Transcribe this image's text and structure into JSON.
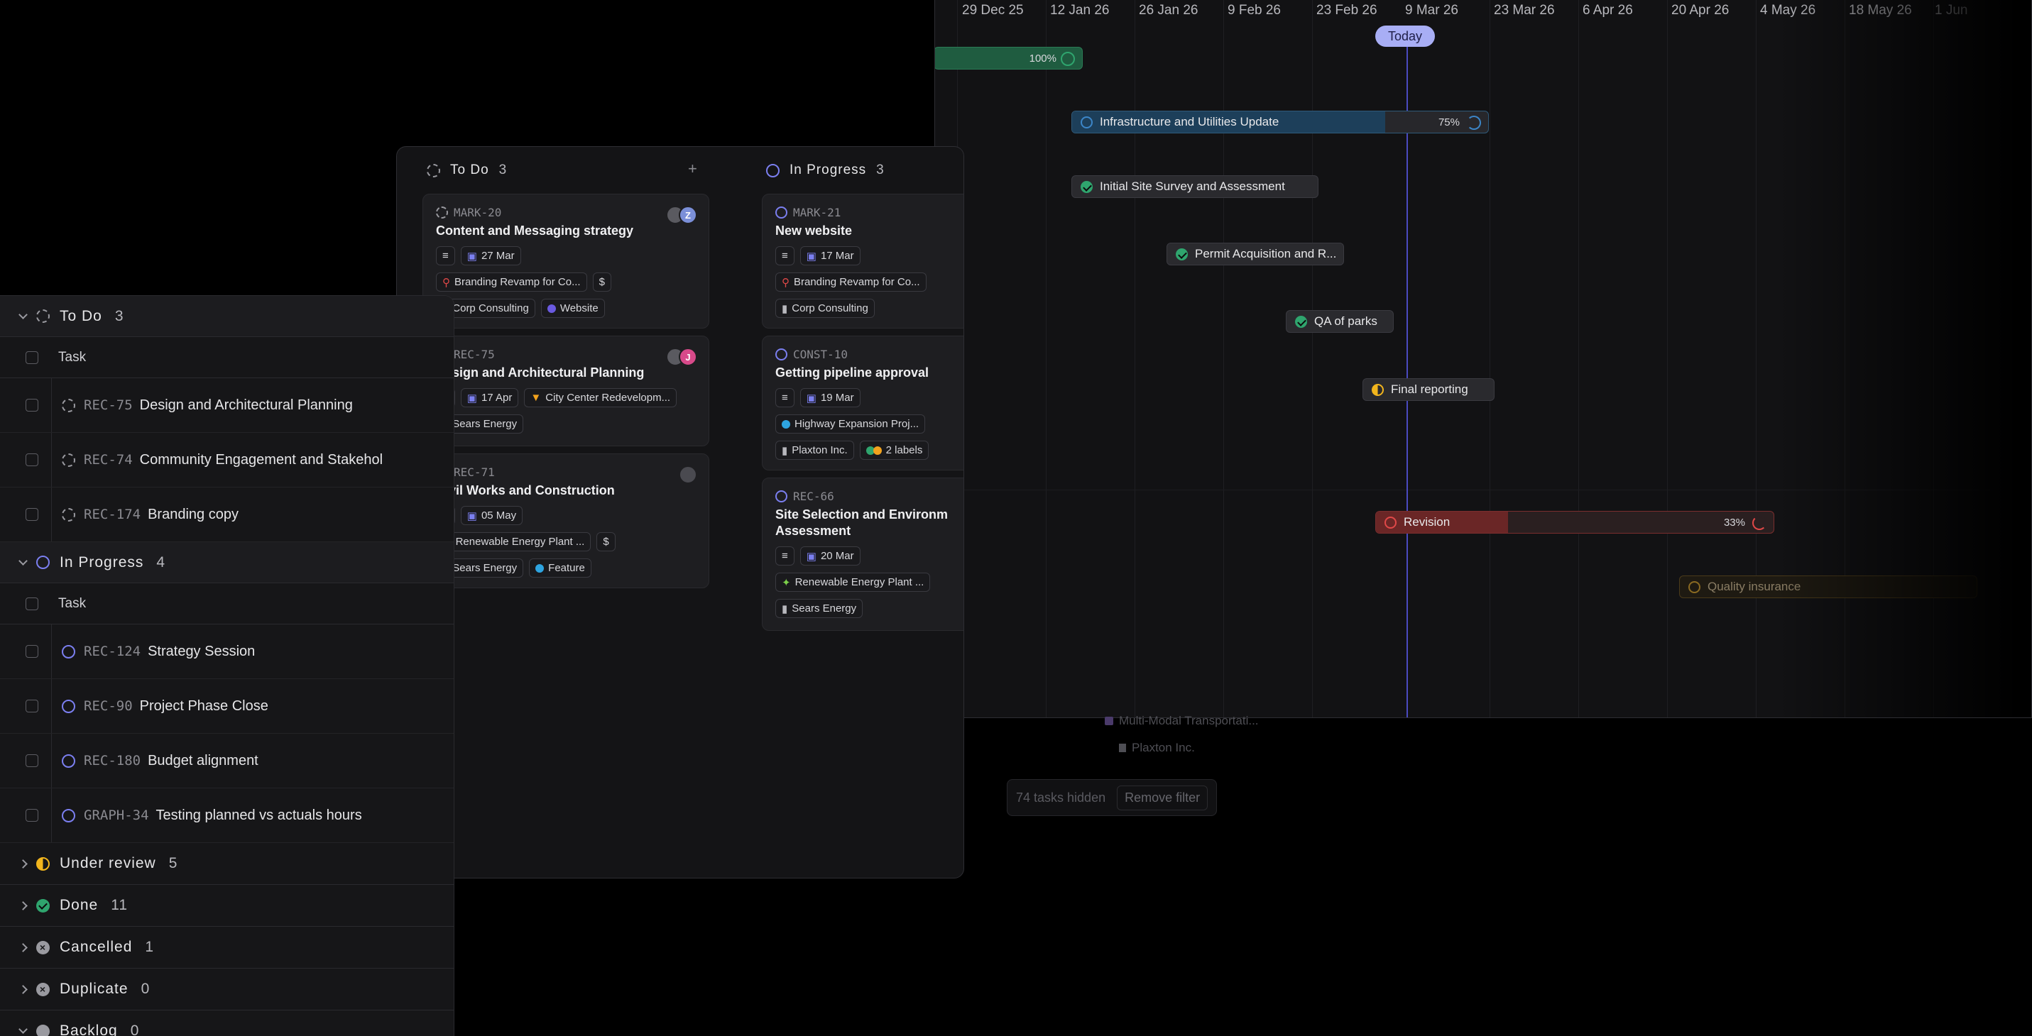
{
  "list": {
    "col_task": "Task",
    "groups": [
      {
        "name": "To Do",
        "count": "3",
        "rows": [
          {
            "id": "REC-75",
            "title": "Design and Architectural Planning"
          },
          {
            "id": "REC-74",
            "title": "Community Engagement and Stakehol"
          },
          {
            "id": "REC-174",
            "title": "Branding copy"
          }
        ]
      },
      {
        "name": "In Progress",
        "count": "4",
        "rows": [
          {
            "id": "REC-124",
            "title": "Strategy Session"
          },
          {
            "id": "REC-90",
            "title": "Project Phase Close"
          },
          {
            "id": "REC-180",
            "title": "Budget alignment"
          },
          {
            "id": "GRAPH-34",
            "title": "Testing planned vs actuals hours"
          }
        ]
      },
      {
        "name": "Under review",
        "count": "5"
      },
      {
        "name": "Done",
        "count": "11"
      },
      {
        "name": "Cancelled",
        "count": "1"
      },
      {
        "name": "Duplicate",
        "count": "0"
      },
      {
        "name": "Backlog",
        "count": "0"
      }
    ]
  },
  "board": {
    "columns": [
      {
        "name": "To Do",
        "count": "3",
        "add": "+"
      },
      {
        "name": "In Progress",
        "count": "3"
      }
    ],
    "todo_cards": [
      {
        "id": "MARK-20",
        "title": "Content and Messaging strategy",
        "date": "27 Mar",
        "project": "Branding Revamp for Co...",
        "currency": "$",
        "client": "Corp Consulting",
        "label": "Website",
        "avatar": "Z"
      },
      {
        "id": "REC-75",
        "title": "Design and Architectural Planning",
        "date": "17 Apr",
        "project": "City Center Redevelopm...",
        "client": "Sears Energy",
        "avatar": "J"
      },
      {
        "id": "REC-71",
        "title": "Civil Works and Construction",
        "date": "05 May",
        "project": "Renewable Energy Plant ...",
        "currency": "$",
        "client": "Sears Energy",
        "label": "Feature"
      }
    ],
    "progress_cards": [
      {
        "id": "MARK-21",
        "title": "New website",
        "date": "17 Mar",
        "project": "Branding Revamp for Co...",
        "client": "Corp Consulting"
      },
      {
        "id": "CONST-10",
        "title": "Getting pipeline approval",
        "date": "19 Mar",
        "project": "Highway Expansion Proj...",
        "client": "Plaxton Inc.",
        "label": "2 labels"
      },
      {
        "id": "REC-66",
        "title_line1": "Site Selection and Environm",
        "title_line2": "Assessment",
        "date": "20 Mar",
        "project": "Renewable Energy Plant ...",
        "client": "Sears Energy"
      }
    ],
    "ghost": {
      "project": "Multi-Modal Transportati...",
      "client": "Plaxton Inc."
    },
    "filter": {
      "hidden": "74 tasks hidden",
      "remove": "Remove filter"
    }
  },
  "gantt": {
    "dates": [
      "29 Dec 25",
      "12 Jan 26",
      "26 Jan 26",
      "9 Feb 26",
      "23 Feb 26",
      "9 Mar 26",
      "23 Mar 26",
      "6 Apr 26",
      "20 Apr 26",
      "4 May 26",
      "18 May 26",
      "1 Jun"
    ],
    "today": "Today",
    "bars": [
      {
        "label": "",
        "pct": "100%"
      },
      {
        "label": "Infrastructure and Utilities Update",
        "pct": "75%"
      },
      {
        "label": "Initial Site Survey and Assessment"
      },
      {
        "label": "Permit Acquisition and R..."
      },
      {
        "label": "QA of parks"
      },
      {
        "label": "Final reporting"
      },
      {
        "label": "Revision",
        "pct": "33%"
      },
      {
        "label": "Quality insurance"
      }
    ],
    "colors": {
      "done": "#2fa56e",
      "progress": "#7b7ff0",
      "review": "#f2b51d",
      "revision": "#e04848",
      "today": "#a8aef5"
    }
  }
}
